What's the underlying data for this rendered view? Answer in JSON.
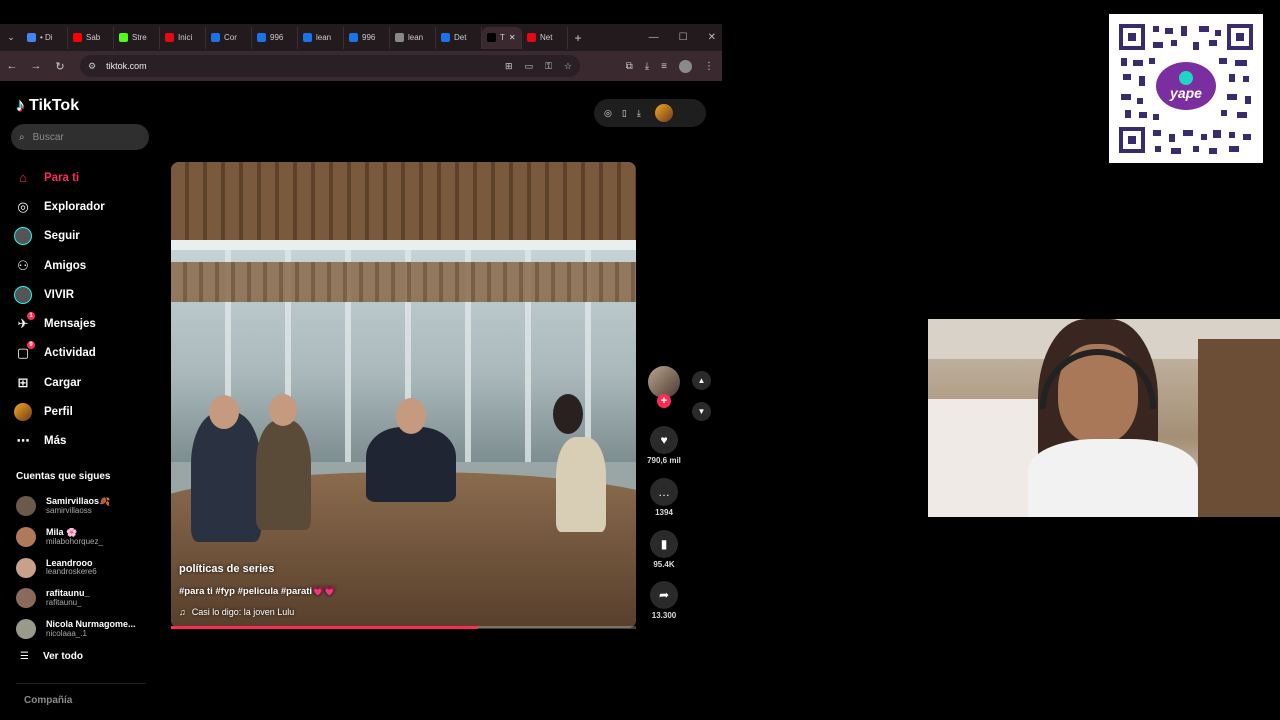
{
  "browser": {
    "tabs": [
      {
        "label": "• Di",
        "color": "#4285f4"
      },
      {
        "label": "Sab",
        "color": "#ff0000"
      },
      {
        "label": "Stre",
        "color": "#53fc18"
      },
      {
        "label": "Inici",
        "color": "#e50914"
      },
      {
        "label": "Cor",
        "color": "#1a73e8"
      },
      {
        "label": "996",
        "color": "#1a73e8"
      },
      {
        "label": "lean",
        "color": "#1a73e8"
      },
      {
        "label": "996",
        "color": "#1a73e8"
      },
      {
        "label": "lean",
        "color": "#888888"
      },
      {
        "label": "Det",
        "color": "#1a73e8"
      },
      {
        "label": "T",
        "color": "#000000",
        "active": true
      },
      {
        "label": "Net",
        "color": "#e50914"
      }
    ],
    "url": "tiktok.com"
  },
  "tiktok": {
    "logo_text": "TikTok",
    "search_placeholder": "Buscar",
    "nav": [
      {
        "label": "Para ti",
        "icon": "home-icon",
        "active": true
      },
      {
        "label": "Explorador",
        "icon": "compass-icon"
      },
      {
        "label": "Seguir",
        "icon": "following-avatar-icon"
      },
      {
        "label": "Amigos",
        "icon": "friends-icon"
      },
      {
        "label": "VIVIR",
        "icon": "live-icon"
      },
      {
        "label": "Mensajes",
        "icon": "messages-icon",
        "badge": "1"
      },
      {
        "label": "Actividad",
        "icon": "activity-icon",
        "badge": "9"
      },
      {
        "label": "Cargar",
        "icon": "upload-icon"
      },
      {
        "label": "Perfil",
        "icon": "profile-icon"
      },
      {
        "label": "Más",
        "icon": "more-icon"
      }
    ],
    "following_title": "Cuentas que sigues",
    "following": [
      {
        "name": "Samirvillaos🍂",
        "user": "samirvillaoss",
        "color": "#6b5a4a"
      },
      {
        "name": "Mila 🌸",
        "user": "milabohorquez_",
        "color": "#b07a5a"
      },
      {
        "name": "Leandrooo",
        "user": "leandroskere6",
        "color": "#c9a08a"
      },
      {
        "name": "rafitaunu_",
        "user": "rafitaunu_",
        "color": "#8a6a5a"
      },
      {
        "name": "Nicola Nurmagome...",
        "user": "nicolaaa_.1",
        "color": "#9a9a8a"
      }
    ],
    "see_all": "Ver todo",
    "company": "Compañía"
  },
  "video": {
    "title": "políticas de series",
    "tags": "#para ti #fyp #pelicula #parati💗💗",
    "music": "Casi lo digo: la joven Lulu",
    "progress": 0.66
  },
  "actions": {
    "likes": "790,6 mil",
    "comments": "1394",
    "saves": "95.4K",
    "shares": "13.300"
  }
}
